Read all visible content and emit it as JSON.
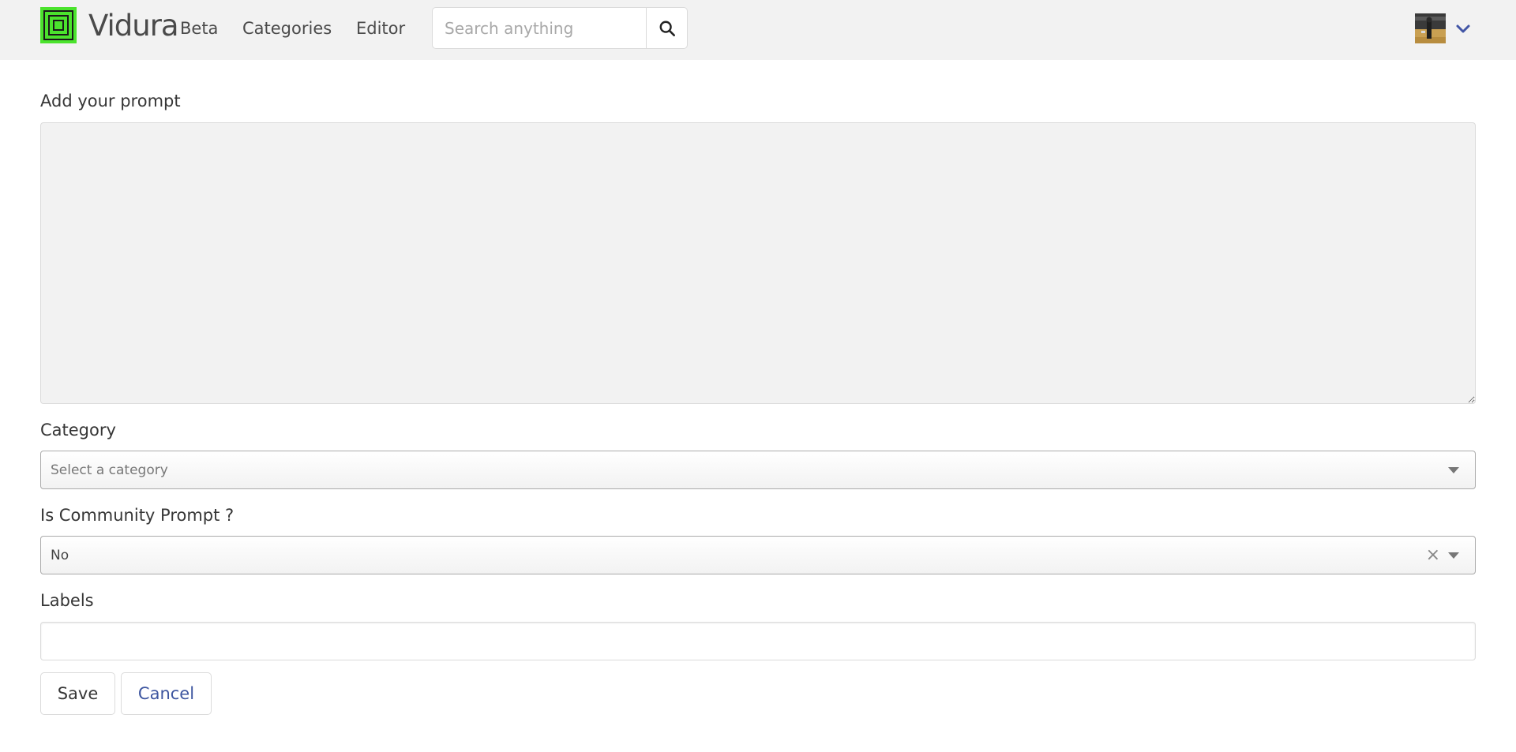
{
  "brand": {
    "name": "Vidura",
    "tag": "Beta",
    "logo_color": "#4be32d"
  },
  "nav": {
    "items": [
      {
        "label": "Categories"
      },
      {
        "label": "Editor"
      }
    ]
  },
  "search": {
    "placeholder": "Search anything",
    "value": "",
    "icon": "search-icon"
  },
  "user": {
    "avatar_icon": "avatar-photo",
    "menu_icon": "chevron-down-icon",
    "accent": "#4256a6"
  },
  "form": {
    "prompt": {
      "label": "Add your prompt",
      "value": ""
    },
    "category": {
      "label": "Category",
      "placeholder": "Select a category"
    },
    "community": {
      "label": "Is Community Prompt ?",
      "value": "No",
      "clear_glyph": "×"
    },
    "labels": {
      "label": "Labels",
      "value": ""
    },
    "actions": {
      "save_label": "Save",
      "cancel_label": "Cancel",
      "cancel_color": "#3e56a0"
    }
  }
}
